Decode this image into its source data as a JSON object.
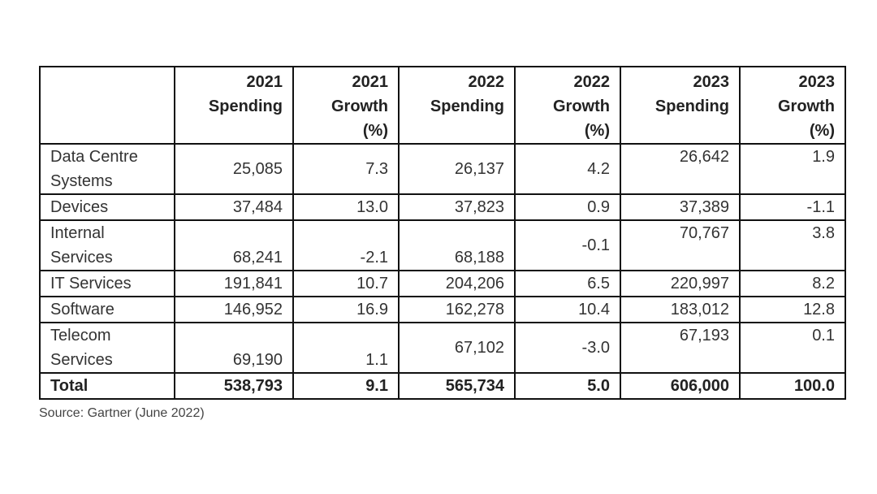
{
  "table": {
    "headers": [
      {
        "lines": [
          "",
          "",
          ""
        ]
      },
      {
        "lines": [
          "2021",
          "Spending",
          ""
        ]
      },
      {
        "lines": [
          "2021",
          "Growth",
          "(%)"
        ]
      },
      {
        "lines": [
          "2022",
          "Spending",
          ""
        ]
      },
      {
        "lines": [
          "2022",
          "Growth",
          "(%)"
        ]
      },
      {
        "lines": [
          "2023",
          "Spending",
          ""
        ]
      },
      {
        "lines": [
          "2023",
          "Growth",
          "(%)"
        ]
      }
    ],
    "rows": [
      {
        "segment": [
          "Data Centre",
          "Systems"
        ],
        "s2021": "25,085",
        "g2021": "7.3",
        "s2022": "26,137",
        "g2022": "4.2",
        "s2023": "26,642",
        "g2023": "1.9"
      },
      {
        "segment": [
          "Devices"
        ],
        "s2021": "37,484",
        "g2021": "13.0",
        "s2022": "37,823",
        "g2022": "0.9",
        "s2023": "37,389",
        "g2023": "-1.1"
      },
      {
        "segment": [
          "Internal",
          "Services"
        ],
        "s2021": "68,241",
        "g2021": "-2.1",
        "s2022": "68,188",
        "g2022": "-0.1",
        "s2023": "70,767",
        "g2023": "3.8"
      },
      {
        "segment": [
          "IT Services"
        ],
        "s2021": "191,841",
        "g2021": "10.7",
        "s2022": "204,206",
        "g2022": "6.5",
        "s2023": "220,997",
        "g2023": "8.2"
      },
      {
        "segment": [
          "Software"
        ],
        "s2021": "146,952",
        "g2021": "16.9",
        "s2022": "162,278",
        "g2022": "10.4",
        "s2023": "183,012",
        "g2023": "12.8"
      },
      {
        "segment": [
          "Telecom",
          "Services"
        ],
        "s2021": "69,190",
        "g2021": "1.1",
        "s2022": "67,102",
        "g2022": "-3.0",
        "s2023": "67,193",
        "g2023": "0.1"
      }
    ],
    "total": {
      "segment": "Total",
      "s2021": "538,793",
      "g2021": "9.1",
      "s2022": "565,734",
      "g2022": "5.0",
      "s2023": "606,000",
      "g2023": "100.0"
    }
  },
  "source": "Source: Gartner (June 2022)"
}
